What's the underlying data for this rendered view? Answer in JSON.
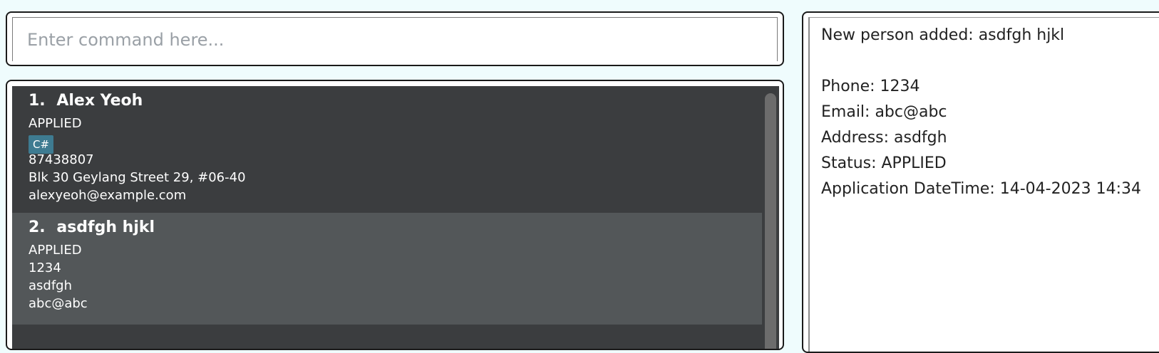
{
  "command": {
    "placeholder": "Enter command here..."
  },
  "persons": [
    {
      "index": "1.",
      "name": "Alex Yeoh",
      "status": "APPLIED",
      "tags": [
        "C#"
      ],
      "phone": "87438807",
      "address": "Blk 30 Geylang Street 29, #06-40",
      "email": "alexyeoh@example.com"
    },
    {
      "index": "2.",
      "name": "asdfgh hjkl",
      "status": "APPLIED",
      "tags": [],
      "phone": "1234",
      "address": "asdfgh",
      "email": "abc@abc"
    }
  ],
  "result": {
    "heading": "New person added: asdfgh hjkl",
    "phone": "Phone: 1234",
    "email": "Email: abc@abc",
    "address": "Address: asdfgh",
    "status": "Status: APPLIED",
    "datetime": "Application DateTime: 14-04-2023 14:34"
  },
  "colors": {
    "background": "#effcfd",
    "card_dark": "#3b3d3f",
    "card_selected": "#535759",
    "tag": "#3e7b91"
  }
}
